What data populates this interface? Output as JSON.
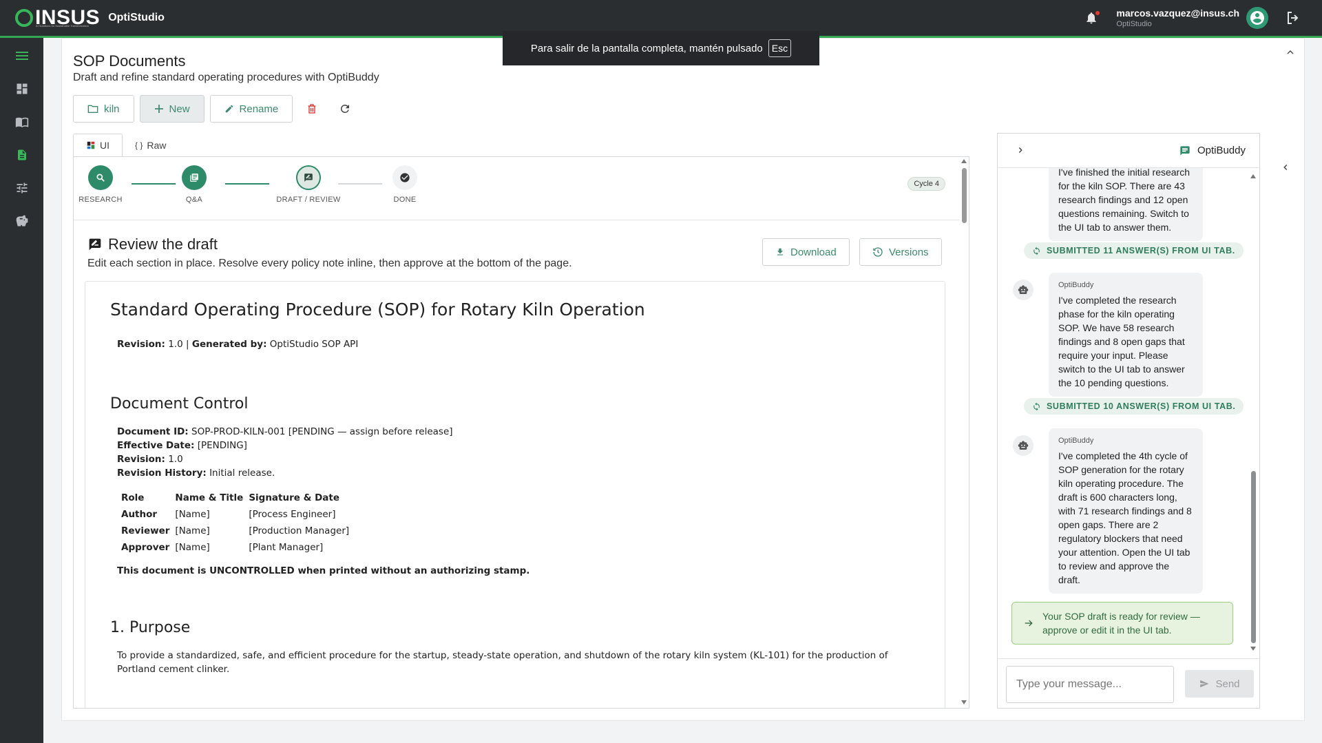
{
  "app": {
    "brand": "INSUS",
    "brand_sub": "AI Solutions for Sustainable Transformation",
    "name": "OptiStudio"
  },
  "user": {
    "email": "marcos.vazquez@insus.ch",
    "org": "OptiStudio"
  },
  "toast": {
    "text": "Para salir de la pantalla completa, mantén pulsado",
    "key": "Esc"
  },
  "page": {
    "title": "SOP Documents",
    "subtitle": "Draft and refine standard operating procedures with OptiBuddy"
  },
  "toolbar": {
    "folder_label": "kiln",
    "new_label": "New",
    "rename_label": "Rename"
  },
  "tabs": [
    {
      "label": "UI"
    },
    {
      "label": "Raw"
    }
  ],
  "stepper": {
    "steps": [
      {
        "label": "RESEARCH",
        "state": "done",
        "icon": "search-icon"
      },
      {
        "label": "Q&A",
        "state": "done",
        "icon": "qa-icon"
      },
      {
        "label": "DRAFT / REVIEW",
        "state": "current",
        "icon": "draft-icon"
      },
      {
        "label": "DONE",
        "state": "pending",
        "icon": "check-icon"
      }
    ],
    "cycle": "Cycle 4"
  },
  "review": {
    "title": "Review the draft",
    "subtitle": "Edit each section in place. Resolve every policy note inline, then approve at the bottom of the page.",
    "download_label": "Download",
    "versions_label": "Versions"
  },
  "doc": {
    "title": "Standard Operating Procedure (SOP) for Rotary Kiln Operation",
    "revision_label": "Revision:",
    "revision_value": "1.0",
    "separator": "|",
    "generated_label": "Generated by:",
    "generated_value": "OptiStudio SOP API",
    "control_heading": "Document Control",
    "control": [
      {
        "label": "Document ID:",
        "value": "SOP-PROD-KILN-001 [PENDING — assign before release]"
      },
      {
        "label": "Effective Date:",
        "value": "[PENDING]"
      },
      {
        "label": "Revision:",
        "value": "1.0"
      },
      {
        "label": "Revision History:",
        "value": "Initial release."
      }
    ],
    "table_headers": [
      "Role",
      "Name & Title",
      "Signature & Date"
    ],
    "table_rows": [
      {
        "role": "Author",
        "name": "[Name]",
        "sig": "[Process Engineer]"
      },
      {
        "role": "Reviewer",
        "name": "[Name]",
        "sig": "[Production Manager]"
      },
      {
        "role": "Approver",
        "name": "[Name]",
        "sig": "[Plant Manager]"
      }
    ],
    "uncontrolled_note": "This document is UNCONTROLLED when printed without an authorizing stamp.",
    "purpose_heading": "1. Purpose",
    "purpose_text": "To provide a standardized, safe, and efficient procedure for the startup, steady-state operation, and shutdown of the rotary kiln system (KL-101) for the production of Portland cement clinker."
  },
  "chat": {
    "title": "OptiBuddy",
    "messages": [
      {
        "sender": "",
        "text": "I've finished the initial research for the kiln SOP. There are 43 research findings and 12 open questions remaining. Switch to the UI tab to answer them."
      },
      {
        "sender": "OptiBuddy",
        "text": "I've completed the research phase for the kiln operating SOP. We have 58 research findings and 8 open gaps that require your input. Please switch to the UI tab to answer the 10 pending questions."
      },
      {
        "sender": "OptiBuddy",
        "text": "I've completed the 4th cycle of SOP generation for the rotary kiln operating procedure. The draft is 600 characters long, with 71 research findings and 8 open gaps. There are 2 regulatory blockers that need your attention. Open the UI tab to review and approve the draft."
      }
    ],
    "system": [
      {
        "text": "SUBMITTED 11 ANSWER(S) FROM UI TAB."
      },
      {
        "text": "SUBMITTED 10 ANSWER(S) FROM UI TAB."
      }
    ],
    "notice": "Your SOP draft is ready for review — approve or edit it in the UI tab.",
    "input_placeholder": "Type your message...",
    "send_label": "Send"
  },
  "colors": {
    "accent": "#2e8b6a",
    "brand_green": "#38b65a",
    "topbar": "#2b2e31"
  }
}
